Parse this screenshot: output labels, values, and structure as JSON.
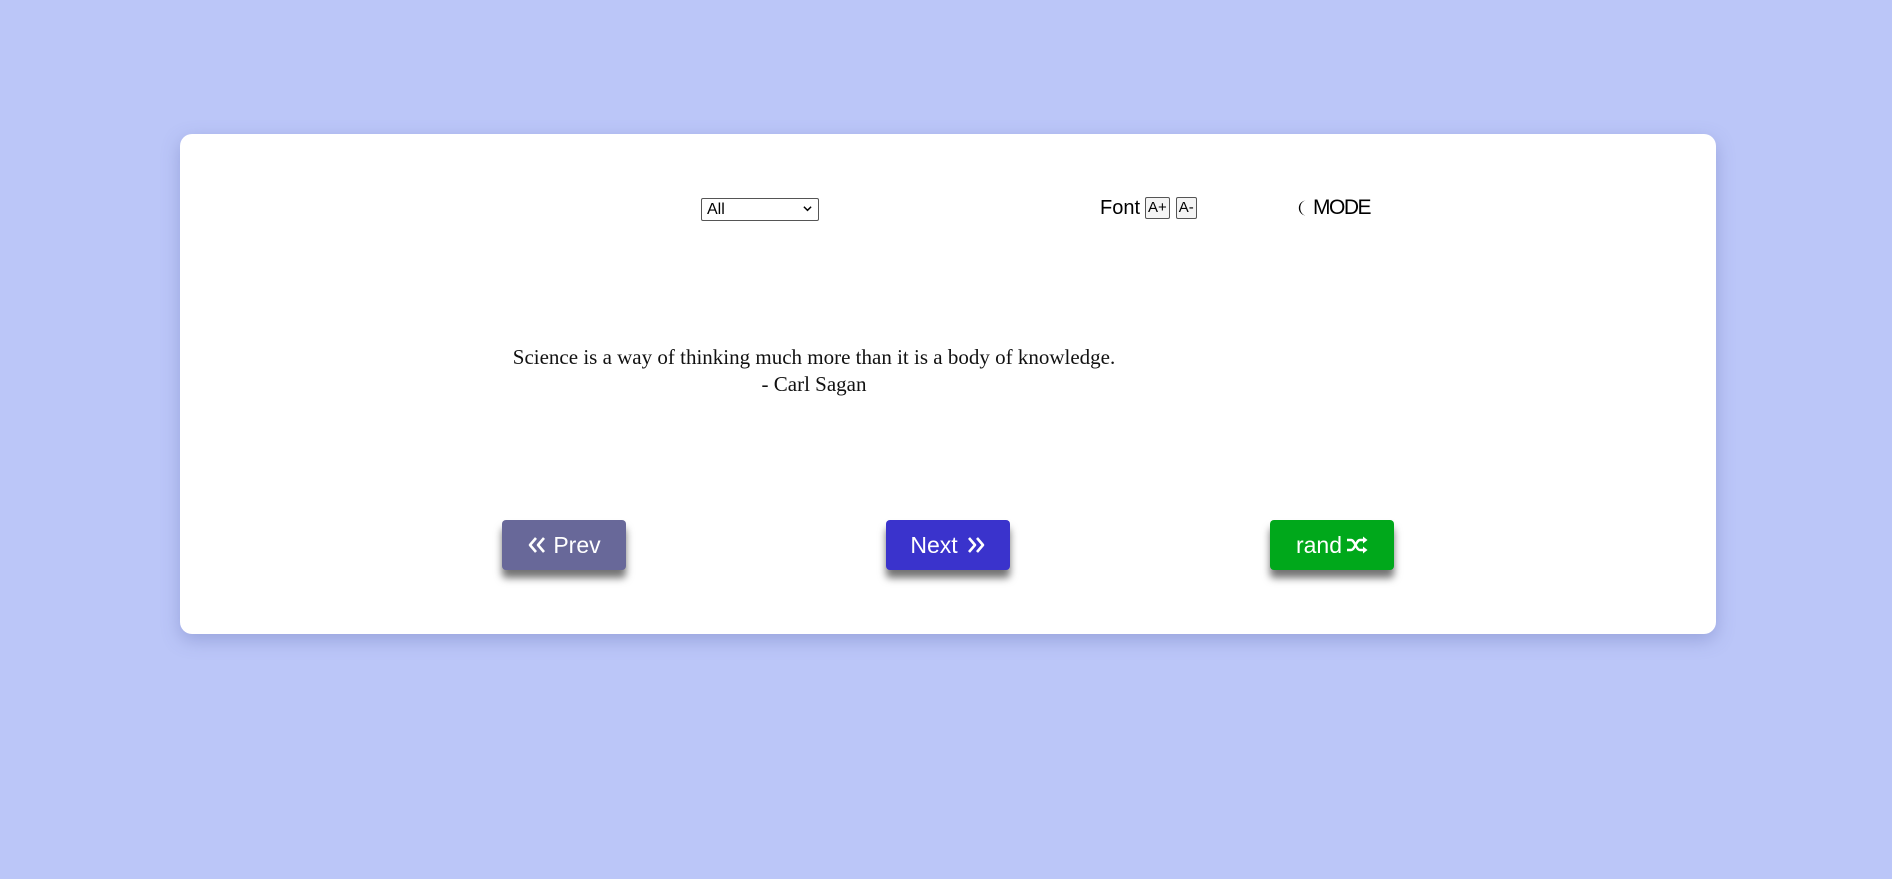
{
  "controls": {
    "category_selected": "All",
    "font_label": "Font",
    "font_increase_label": "A+",
    "font_decrease_label": "A-",
    "mode_label": "MODE",
    "mode_icon": "moon-icon"
  },
  "quote": {
    "text": "Science is a way of thinking much more than it is a body of knowledge.",
    "author": "- Carl Sagan"
  },
  "navigation": {
    "prev_label": "Prev",
    "next_label": "Next",
    "random_label": "rand"
  },
  "colors": {
    "page_background": "#bbc6f8",
    "prev_button": "#686899",
    "next_button": "#3a33cc",
    "random_button": "#00a81b"
  }
}
